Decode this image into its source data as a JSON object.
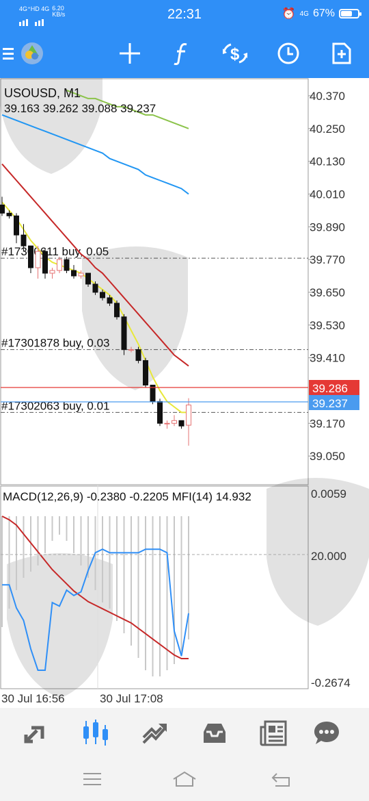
{
  "status_bar": {
    "network_left": "4G⁺HD 4G",
    "speed": "6.20",
    "speed_unit": "KB/s",
    "time": "22:31",
    "network_right": "4G",
    "battery": "67%",
    "battery_level": 0.67
  },
  "toolbar": {
    "icons": [
      "menu-icon",
      "app-logo-icon",
      "crosshair-icon",
      "function-icon",
      "symbol-switch-icon",
      "timeframe-clock-icon",
      "new-order-icon"
    ]
  },
  "chart": {
    "symbol_title": "USOUSD, M1",
    "ohlc_text": "39.163 39.262 39.088 39.237",
    "price_axis": [
      "40.370",
      "40.250",
      "40.130",
      "40.010",
      "39.890",
      "39.770",
      "39.650",
      "39.530",
      "39.410",
      "39.170",
      "39.050"
    ],
    "price_range": [
      38.95,
      40.43
    ],
    "bid_price": "39.286",
    "ask_price": "39.237",
    "orders": [
      {
        "label": "#17300611 buy, 0.05",
        "price": 39.775
      },
      {
        "label": "#17301878 buy, 0.03",
        "price": 39.44
      },
      {
        "label": "#17302063 buy, 0.01",
        "price": 39.21
      }
    ],
    "indicator_title": "MACD(12,26,9) -0.2380 -0.2205 MFI(14) 14.932",
    "indicator_axis": [
      "0.0059",
      "20.000",
      "-0.2674"
    ],
    "time_labels": [
      "30 Jul 16:56",
      "30 Jul 17:08"
    ],
    "bid_color": "#e53935",
    "ask_color": "#4a9bef",
    "accent_color": "#2f8ff7"
  },
  "chart_data": {
    "type": "line",
    "title": "USOUSD, M1",
    "candles": [
      {
        "o": 39.97,
        "h": 40.0,
        "l": 39.93,
        "c": 39.94
      },
      {
        "o": 39.94,
        "h": 39.95,
        "l": 39.92,
        "c": 39.93
      },
      {
        "o": 39.93,
        "h": 39.94,
        "l": 39.83,
        "c": 39.86
      },
      {
        "o": 39.86,
        "h": 39.9,
        "l": 39.8,
        "c": 39.82
      },
      {
        "o": 39.82,
        "h": 39.82,
        "l": 39.72,
        "c": 39.74
      },
      {
        "o": 39.74,
        "h": 39.82,
        "l": 39.7,
        "c": 39.8
      },
      {
        "o": 39.8,
        "h": 39.81,
        "l": 39.7,
        "c": 39.72
      },
      {
        "o": 39.72,
        "h": 39.74,
        "l": 39.7,
        "c": 39.73
      },
      {
        "o": 39.73,
        "h": 39.78,
        "l": 39.72,
        "c": 39.77
      },
      {
        "o": 39.77,
        "h": 39.78,
        "l": 39.72,
        "c": 39.73
      },
      {
        "o": 39.73,
        "h": 39.75,
        "l": 39.7,
        "c": 39.71
      },
      {
        "o": 39.71,
        "h": 39.73,
        "l": 39.7,
        "c": 39.72
      },
      {
        "o": 39.72,
        "h": 39.72,
        "l": 39.67,
        "c": 39.68
      },
      {
        "o": 39.68,
        "h": 39.69,
        "l": 39.64,
        "c": 39.65
      },
      {
        "o": 39.65,
        "h": 39.66,
        "l": 39.62,
        "c": 39.63
      },
      {
        "o": 39.63,
        "h": 39.64,
        "l": 39.6,
        "c": 39.61
      },
      {
        "o": 39.61,
        "h": 39.62,
        "l": 39.55,
        "c": 39.56
      },
      {
        "o": 39.56,
        "h": 39.57,
        "l": 39.42,
        "c": 39.44
      },
      {
        "o": 39.44,
        "h": 39.45,
        "l": 39.43,
        "c": 39.44
      },
      {
        "o": 39.44,
        "h": 39.45,
        "l": 39.39,
        "c": 39.4
      },
      {
        "o": 39.4,
        "h": 39.41,
        "l": 39.3,
        "c": 39.31
      },
      {
        "o": 39.31,
        "h": 39.31,
        "l": 39.24,
        "c": 39.25
      },
      {
        "o": 39.25,
        "h": 39.26,
        "l": 39.16,
        "c": 39.17
      },
      {
        "o": 39.17,
        "h": 39.18,
        "l": 39.15,
        "c": 39.17
      },
      {
        "o": 39.17,
        "h": 39.2,
        "l": 39.16,
        "c": 39.18
      },
      {
        "o": 39.18,
        "h": 39.18,
        "l": 39.15,
        "c": 39.16
      },
      {
        "o": 39.163,
        "h": 39.262,
        "l": 39.088,
        "c": 39.237
      }
    ],
    "ma_fast": [
      39.98,
      39.95,
      39.92,
      39.88,
      39.84,
      39.81,
      39.78,
      39.76,
      39.75,
      39.74,
      39.73,
      39.72,
      39.7,
      39.68,
      39.66,
      39.64,
      39.61,
      39.56,
      39.51,
      39.46,
      39.4,
      39.34,
      39.29,
      39.25,
      39.23,
      39.21,
      39.21
    ],
    "ma_mid": [
      40.12,
      40.09,
      40.06,
      40.03,
      40.0,
      39.97,
      39.94,
      39.91,
      39.88,
      39.85,
      39.82,
      39.79,
      39.77,
      39.74,
      39.72,
      39.69,
      39.66,
      39.63,
      39.6,
      39.57,
      39.54,
      39.51,
      39.48,
      39.45,
      39.42,
      39.4,
      39.38
    ],
    "ma_slow_blue": [
      40.3,
      40.29,
      40.28,
      40.27,
      40.26,
      40.25,
      40.24,
      40.23,
      40.22,
      40.21,
      40.2,
      40.19,
      40.18,
      40.17,
      40.16,
      40.14,
      40.13,
      40.12,
      40.11,
      40.1,
      40.08,
      40.07,
      40.06,
      40.05,
      40.04,
      40.03,
      40.01
    ],
    "ma_slow_green": [
      null,
      null,
      null,
      null,
      null,
      null,
      null,
      null,
      null,
      40.39,
      40.38,
      40.37,
      40.36,
      40.36,
      40.35,
      40.34,
      40.33,
      40.33,
      40.32,
      40.31,
      40.3,
      40.3,
      40.29,
      40.28,
      40.27,
      40.26,
      40.25
    ],
    "mfi_line": [
      48,
      48,
      35,
      28,
      12,
      0,
      0,
      38,
      36,
      45,
      42,
      44,
      56,
      66,
      68,
      66,
      66,
      66,
      66,
      66,
      68,
      68,
      68,
      66,
      22,
      8,
      32
    ],
    "macd_signal": [
      60,
      58,
      55,
      50,
      45,
      40,
      35,
      30,
      26,
      22,
      18,
      15,
      12,
      10,
      8,
      6,
      4,
      2,
      0,
      -3,
      -6,
      -9,
      -12,
      -15,
      -18,
      -20,
      -20
    ],
    "macd_hist": [
      18,
      15,
      12,
      10,
      9,
      8,
      6,
      4,
      3,
      4,
      6,
      8,
      10,
      12,
      14,
      15,
      17,
      19,
      21,
      23,
      25,
      26,
      26,
      25,
      24,
      22,
      20
    ]
  },
  "bottom_nav": {
    "items": [
      "quotes-icon",
      "chart-icon",
      "trade-icon",
      "history-icon",
      "news-icon",
      "chat-icon"
    ],
    "active": "chart-icon"
  }
}
